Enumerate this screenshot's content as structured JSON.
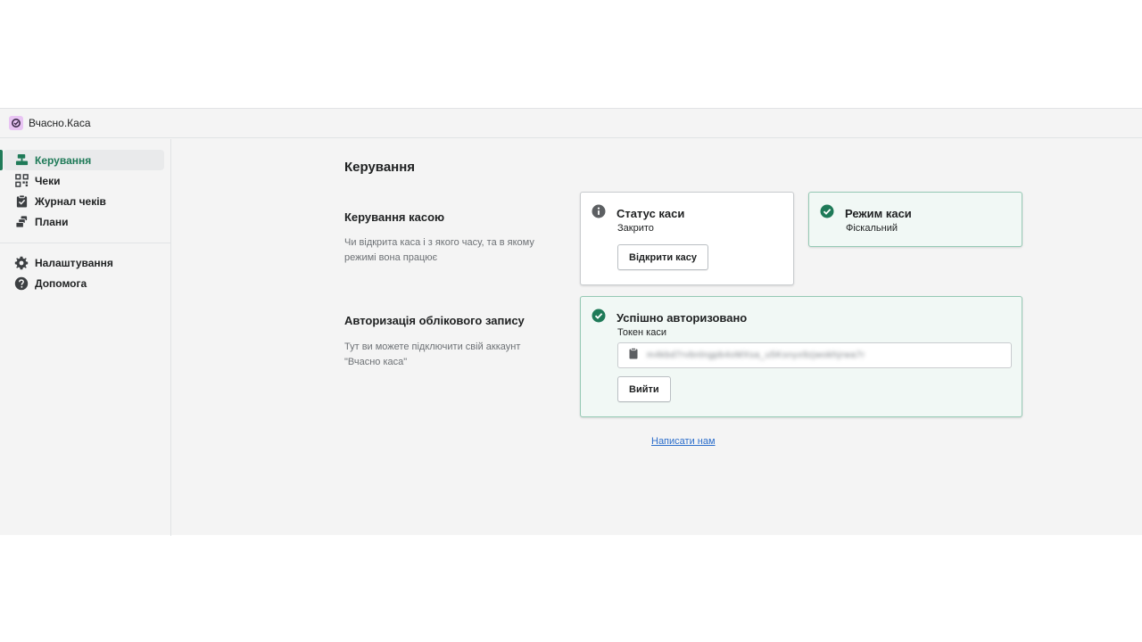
{
  "app": {
    "title": "Вчасно.Каса",
    "logo_color": "#e8c4f3"
  },
  "sidebar": {
    "items": [
      {
        "label": "Керування",
        "icon": "cash-register-icon",
        "active": true
      },
      {
        "label": "Чеки",
        "icon": "qr-grid-icon"
      },
      {
        "label": "Журнал чеків",
        "icon": "clipboard-check-icon"
      },
      {
        "label": "Плани",
        "icon": "stack-icon"
      }
    ],
    "bottom_items": [
      {
        "label": "Налаштування",
        "icon": "gear-icon"
      },
      {
        "label": "Допомога",
        "icon": "help-icon"
      }
    ]
  },
  "page": {
    "title": "Керування",
    "sections": [
      {
        "title": "Керування касою",
        "description": "Чи відкрита каса і з якого часу, та в якому режимі вона працює"
      },
      {
        "title": "Авторизація облікового запису",
        "description": "Тут ви можете підключити свій аккаунт \"Вчасно каса\""
      }
    ],
    "status_card": {
      "title": "Статус каси",
      "value": "Закрито",
      "button": "Відкрити касу",
      "icon": "info-icon"
    },
    "mode_card": {
      "title": "Режим каси",
      "value": "Фіскальний",
      "icon": "check-circle-icon"
    },
    "auth_card": {
      "title": "Успішно авторизовано",
      "token_label": "Токен каси",
      "token_value": "m4kbd7rvbnlngpb4oMXsa_u5Ksnyx9zjwokhjrwa7r",
      "button": "Вийти",
      "icon": "check-circle-icon"
    },
    "contact_link": "Написати нам"
  },
  "colors": {
    "accent": "#1f7a58",
    "success_bg": "#f1f8f5",
    "success_border": "#95c9b4",
    "link": "#2c6ecb"
  }
}
